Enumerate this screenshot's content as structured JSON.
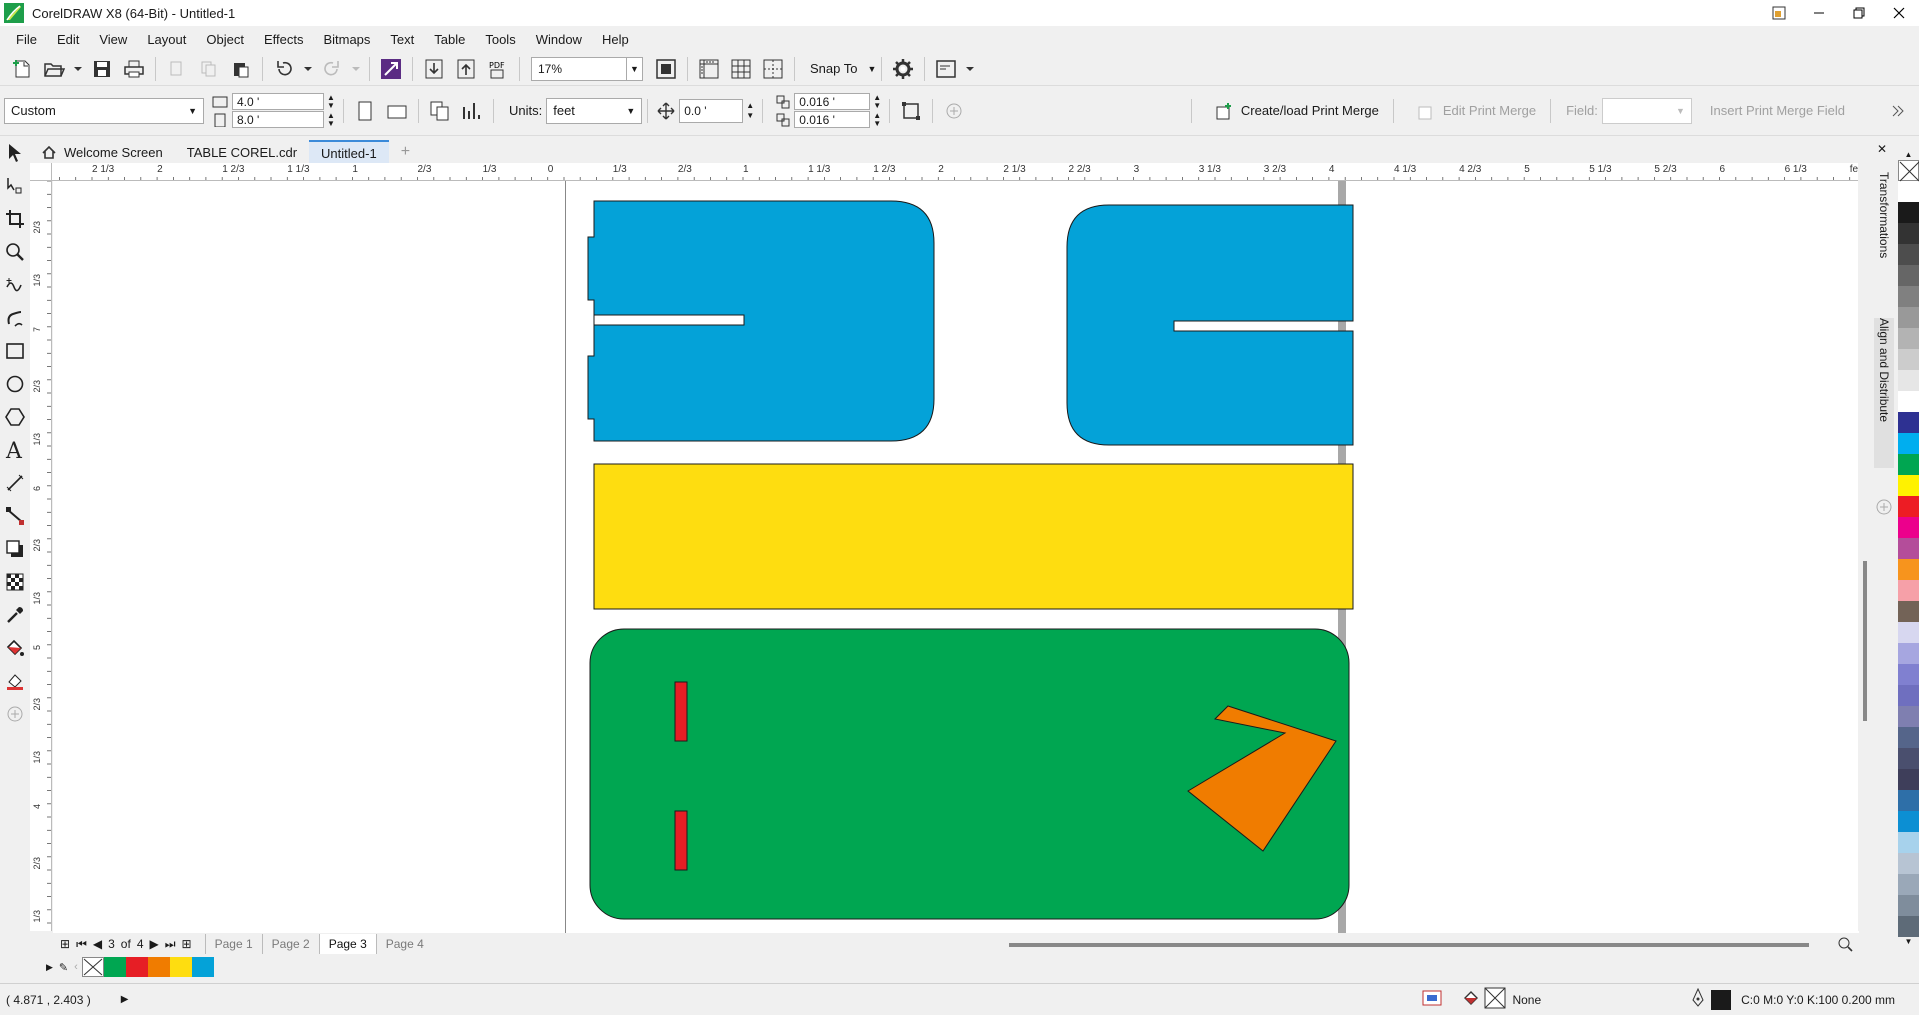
{
  "window": {
    "title": "CorelDRAW X8 (64-Bit) - Untitled-1"
  },
  "menu": [
    "File",
    "Edit",
    "View",
    "Layout",
    "Object",
    "Effects",
    "Bitmaps",
    "Text",
    "Table",
    "Tools",
    "Window",
    "Help"
  ],
  "toolbar": {
    "zoom": "17%",
    "snap_label": "Snap To"
  },
  "propbar": {
    "page_size": "Custom",
    "width": "4.0 '",
    "height": "8.0 '",
    "units_label": "Units:",
    "units": "feet",
    "nudge": "0.0 '",
    "dup_x": "0.016 '",
    "dup_y": "0.016 '",
    "print_merge_create": "Create/load Print Merge",
    "print_merge_edit": "Edit Print Merge",
    "field_label": "Field:",
    "insert_field": "Insert Print Merge Field"
  },
  "tabs": [
    {
      "label": "Welcome Screen",
      "active": false
    },
    {
      "label": "TABLE COREL.cdr",
      "active": false
    },
    {
      "label": "Untitled-1",
      "active": true
    }
  ],
  "ruler": {
    "h_labels": [
      "2 1/3",
      "2",
      "1 2/3",
      "1 1/3",
      "1",
      "2/3",
      "1/3",
      "0",
      "1/3",
      "2/3",
      "1",
      "1 1/3",
      "1 2/3",
      "2",
      "2 1/3",
      "2 2/3",
      "3",
      "3 1/3",
      "3 2/3",
      "4",
      "4 1/3",
      "4 2/3",
      "5",
      "5 1/3",
      "5 2/3",
      "6",
      "6 1/3",
      "feet"
    ],
    "v_labels": [
      "2/3",
      "1/3",
      "7",
      "2/3",
      "1/3",
      "6",
      "2/3",
      "1/3",
      "5",
      "2/3",
      "1/3",
      "4",
      "2/3",
      "1/3"
    ]
  },
  "pages": {
    "current": "3",
    "of_label": "of",
    "total": "4",
    "tabs": [
      "Page 1",
      "Page 2",
      "Page 3",
      "Page 4"
    ],
    "active_index": 2
  },
  "dockers": [
    "Transformations",
    "Align and Distribute"
  ],
  "colors": {
    "blue": "#04a2d8",
    "yellow": "#fedd10",
    "green": "#00a651",
    "red": "#e61e25",
    "orange": "#f07c00"
  },
  "palette": [
    "#ffffff",
    "#1a1a1a",
    "#333333",
    "#4d4d4d",
    "#666666",
    "#808080",
    "#999999",
    "#b3b3b3",
    "#cccccc",
    "#e6e6e6",
    "#ffffff",
    "#2e3192",
    "#00aeef",
    "#00a651",
    "#fff200",
    "#ed1c24",
    "#ec008c",
    "#b44d9a",
    "#f7941d",
    "#f6a0a8",
    "#736357",
    "#d7d7f0",
    "#a6a6e0",
    "#8080d0",
    "#6f6fbf",
    "#7f7fb0",
    "#55658a",
    "#4a4f6e",
    "#3e3e5a",
    "#2e6fa8",
    "#0c8fd3",
    "#a7d2ec",
    "#b7c4d3",
    "#9aa8b8",
    "#7f8d9c",
    "#5e6b78"
  ],
  "doc_palette": [
    "#00a651",
    "#e61e25",
    "#f07c00",
    "#fedd10",
    "#04a2d8"
  ],
  "status": {
    "coords": "( 4.871 , 2.403  )",
    "fill_none": "None",
    "outline": "C:0 M:0 Y:0 K:100  0.200 mm"
  }
}
